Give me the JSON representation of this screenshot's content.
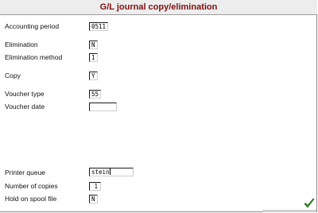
{
  "window": {
    "title": "G/L journal copy/elimination"
  },
  "form": {
    "accounting_period": {
      "label": "Accounting period",
      "value": "0511"
    },
    "elimination": {
      "label": "Elimination",
      "value": "N"
    },
    "elimination_method": {
      "label": "Elimination method",
      "value": "1"
    },
    "copy": {
      "label": "Copy",
      "value": "Y"
    },
    "voucher_type": {
      "label": "Voucher type",
      "value": "55"
    },
    "voucher_date": {
      "label": "Voucher date",
      "value": ""
    },
    "printer_queue": {
      "label": "Printer queue",
      "value": "stein"
    },
    "number_of_copies": {
      "label": "Number of copies",
      "value": "1"
    },
    "hold_on_spool_file": {
      "label": "Hold on spool file",
      "value": "N"
    }
  },
  "icons": {
    "ok": "checkmark-icon"
  },
  "colors": {
    "title": "#7e1010",
    "checkmark": "#2f8a1f"
  }
}
